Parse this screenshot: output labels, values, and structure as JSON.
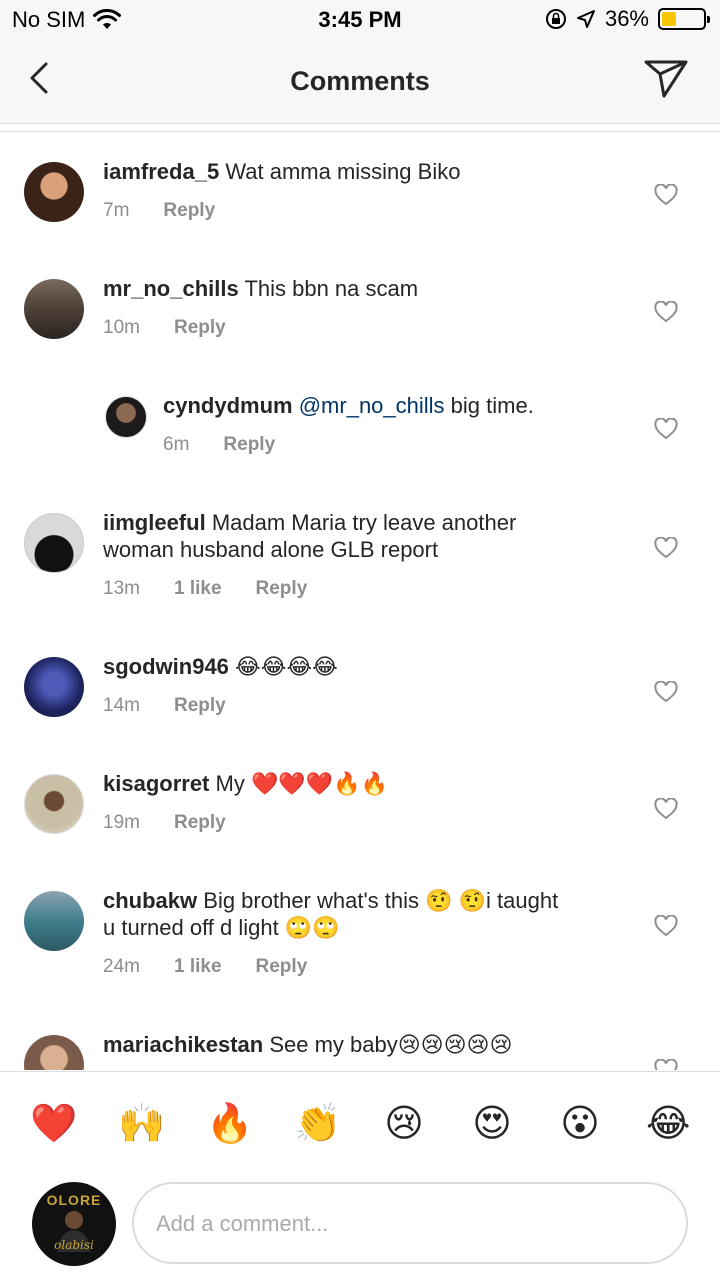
{
  "status": {
    "carrier": "No SIM",
    "time": "3:45 PM",
    "battery": "36%",
    "battery_level": 0.36
  },
  "header": {
    "title": "Comments"
  },
  "comments": [
    {
      "user": "iamfreda_5",
      "text": "Wat amma missing Biko",
      "time": "7m",
      "likes": "",
      "reply": "Reply"
    },
    {
      "user": "mr_no_chills",
      "text": "This bbn na scam",
      "time": "10m",
      "likes": "",
      "reply": "Reply"
    },
    {
      "user": "cyndydmum",
      "mention": "@mr_no_chills",
      "text": "big time.",
      "time": "6m",
      "likes": "",
      "reply": "Reply"
    },
    {
      "user": "iimgleeful",
      "text": "Madam Maria try leave another",
      "text2": "woman husband alone GLB report",
      "time": "13m",
      "likes": "1 like",
      "reply": "Reply"
    },
    {
      "user": "sgodwin946",
      "text": "😂😂😂😂",
      "time": "14m",
      "likes": "",
      "reply": "Reply"
    },
    {
      "user": "kisagorret",
      "text": "My ❤️❤️❤️🔥🔥",
      "time": "19m",
      "likes": "",
      "reply": "Reply"
    },
    {
      "user": "chubakw",
      "text": "Big brother what's this 🤨 🤨i taught",
      "text2": "u turned off d light 🙄🙄",
      "time": "24m",
      "likes": "1 like",
      "reply": "Reply"
    },
    {
      "user": "mariachikestan",
      "text": "See my baby😢😢😢😢😢"
    }
  ],
  "emoji_bar": [
    "❤️",
    "🙌",
    "🔥",
    "👏",
    "😢",
    "😍",
    "😮",
    "😂"
  ],
  "composer": {
    "avatar_text": "OLORE",
    "avatar_script": "olabisi",
    "placeholder": "Add a comment..."
  },
  "colors": {
    "mention": "#003569",
    "meta": "#8e8e8e",
    "battery": "#f7c600"
  }
}
